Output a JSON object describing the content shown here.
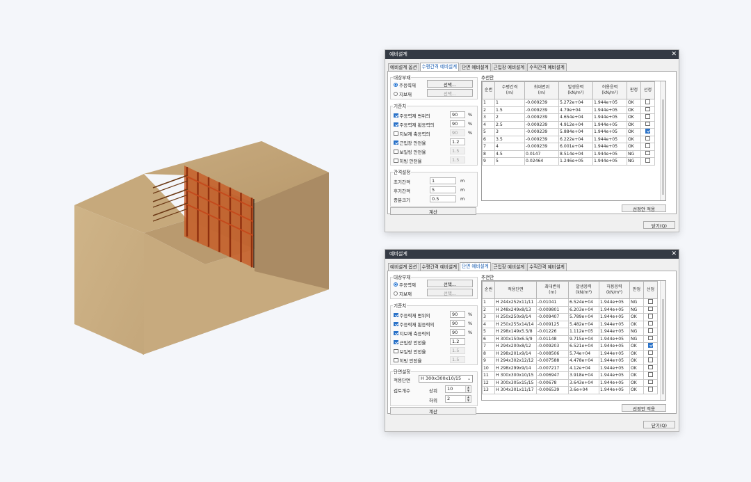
{
  "colors": {
    "titlebar": "#343a44",
    "tab_active_text": "#1c5fb2",
    "check_blue": "#2a72c8",
    "soil_top": "#c2a578",
    "soil_front": "#c9ab7f",
    "soil_side": "#9b7f5a",
    "steel": "#c44a1c"
  },
  "dialog1": {
    "title": "예비설계",
    "close_icon": "✕",
    "tabs": [
      "예비설계 옵션",
      "수평간격 예비설계",
      "단면 예비설계",
      "근입장 예비설계",
      "수직간격 예비설계"
    ],
    "active_tab": 1,
    "target": {
      "group": "대상부재",
      "main": "주응력재",
      "sub": "지보재",
      "select": "선택...",
      "select_sub": "선택..."
    },
    "criteria": {
      "group": "기준치",
      "items": [
        {
          "label": "주응력재 변위의",
          "value": "90",
          "unit": "%",
          "checked": true
        },
        {
          "label": "주응력재 휨응력의",
          "value": "90",
          "unit": "%",
          "checked": true
        },
        {
          "label": "지보재 축응력의",
          "value": "90",
          "unit": "%",
          "checked": false
        },
        {
          "label": "근입장 안전율",
          "value": "1.2",
          "unit": "",
          "checked": true
        },
        {
          "label": "보일링 안전율",
          "value": "1.5",
          "unit": "",
          "checked": false
        },
        {
          "label": "히빙 안전율",
          "value": "1.5",
          "unit": "",
          "checked": false
        }
      ]
    },
    "spacing": {
      "group": "간격설정",
      "items": [
        {
          "label": "초기간격",
          "value": "1",
          "unit": "m"
        },
        {
          "label": "후기간격",
          "value": "5",
          "unit": "m"
        },
        {
          "label": "증분크기",
          "value": "0.5",
          "unit": "m"
        }
      ]
    },
    "calc": "계산",
    "result_title": "추천안",
    "columns": [
      "순번",
      "수평간격\n(m)",
      "최대변위\n(m)",
      "발생응력\n(kN/m²)",
      "허용응력\n(kN/m²)",
      "판정",
      "선정"
    ],
    "rows": [
      [
        "1",
        "1",
        "-0.009239",
        "5.272e+04",
        "1.944e+05",
        "OK",
        false
      ],
      [
        "2",
        "1.5",
        "-0.009239",
        "4.79e+04",
        "1.944e+05",
        "OK",
        false
      ],
      [
        "3",
        "2",
        "-0.009239",
        "4.654e+04",
        "1.944e+05",
        "OK",
        false
      ],
      [
        "4",
        "2.5",
        "-0.009239",
        "4.912e+04",
        "1.944e+05",
        "OK",
        false
      ],
      [
        "5",
        "3",
        "-0.009239",
        "5.884e+04",
        "1.944e+05",
        "OK",
        true
      ],
      [
        "6",
        "3.5",
        "-0.009239",
        "6.222e+04",
        "1.944e+05",
        "OK",
        false
      ],
      [
        "7",
        "4",
        "-0.009239",
        "6.001e+04",
        "1.944e+05",
        "OK",
        false
      ],
      [
        "8",
        "4.5",
        "0.0147",
        "8.514e+04",
        "1.944e+05",
        "NG",
        false
      ],
      [
        "9",
        "5",
        "0.02464",
        "1.246e+05",
        "1.944e+05",
        "NG",
        false
      ]
    ],
    "apply": "선정안 적용",
    "close": "닫기(Q)"
  },
  "dialog2": {
    "title": "예비설계",
    "close_icon": "✕",
    "tabs": [
      "예비설계 옵션",
      "수평간격 예비설계",
      "단면 예비설계",
      "근입장 예비설계",
      "수직간격 예비설계"
    ],
    "active_tab": 2,
    "target": {
      "group": "대상부재",
      "main": "주응력재",
      "sub": "지보재",
      "select": "선택...",
      "select_sub": "선택..."
    },
    "criteria": {
      "group": "기준치",
      "items": [
        {
          "label": "주응력재 변위의",
          "value": "90",
          "unit": "%",
          "checked": true
        },
        {
          "label": "주응력재 휨응력의",
          "value": "90",
          "unit": "%",
          "checked": true
        },
        {
          "label": "지보재 축응력의",
          "value": "90",
          "unit": "%",
          "checked": true
        },
        {
          "label": "근입장 안전율",
          "value": "1.2",
          "unit": "",
          "checked": true
        },
        {
          "label": "보일링 안전율",
          "value": "1.5",
          "unit": "",
          "checked": false
        },
        {
          "label": "히빙 안전율",
          "value": "1.5",
          "unit": "",
          "checked": false
        }
      ]
    },
    "section": {
      "group": "단면설정",
      "apply_label": "적용단면",
      "apply_value": "H 300x300x10/15",
      "review_label": "검토개수",
      "upper_label": "상위",
      "upper_value": "10",
      "lower_label": "하위",
      "lower_value": "2"
    },
    "calc": "계산",
    "result_title": "추천안",
    "columns": [
      "순번",
      "적용단면",
      "최대변위\n(m)",
      "발생응력\n(kN/m²)",
      "허용응력\n(kN/m²)",
      "판정",
      "선정"
    ],
    "rows": [
      [
        "1",
        "H 244x252x11/11",
        "-0.01041",
        "6.524e+04",
        "1.944e+05",
        "NG",
        false
      ],
      [
        "2",
        "H 248x249x8/13",
        "-0.009801",
        "6.203e+04",
        "1.944e+05",
        "NG",
        false
      ],
      [
        "3",
        "H 250x250x9/14",
        "-0.009407",
        "5.789e+04",
        "1.944e+05",
        "OK",
        false
      ],
      [
        "4",
        "H 250x255x14/14",
        "-0.009125",
        "5.482e+04",
        "1.944e+05",
        "OK",
        false
      ],
      [
        "5",
        "H 298x149x5.5/8",
        "-0.01226",
        "1.112e+05",
        "1.944e+05",
        "NG",
        false
      ],
      [
        "6",
        "H 300x150x6.5/9",
        "-0.01148",
        "9.715e+04",
        "1.944e+05",
        "NG",
        false
      ],
      [
        "7",
        "H 294x200x8/12",
        "-0.009203",
        "6.521e+04",
        "1.944e+05",
        "OK",
        true
      ],
      [
        "8",
        "H 298x201x9/14",
        "-0.008506",
        "5.74e+04",
        "1.944e+05",
        "OK",
        false
      ],
      [
        "9",
        "H 294x302x12/12",
        "-0.007588",
        "4.478e+04",
        "1.944e+05",
        "OK",
        false
      ],
      [
        "10",
        "H 298x299x9/14",
        "-0.007217",
        "4.12e+04",
        "1.944e+05",
        "OK",
        false
      ],
      [
        "11",
        "H 300x300x10/15",
        "-0.006947",
        "3.918e+04",
        "1.944e+05",
        "OK",
        false
      ],
      [
        "12",
        "H 300x305x15/15",
        "-0.00678",
        "3.643e+04",
        "1.944e+05",
        "OK",
        false
      ],
      [
        "13",
        "H 304x301x11/17",
        "-0.006539",
        "3.6e+04",
        "1.944e+05",
        "OK",
        false
      ]
    ],
    "apply": "선정안 적용",
    "close": "닫기(Q)"
  }
}
